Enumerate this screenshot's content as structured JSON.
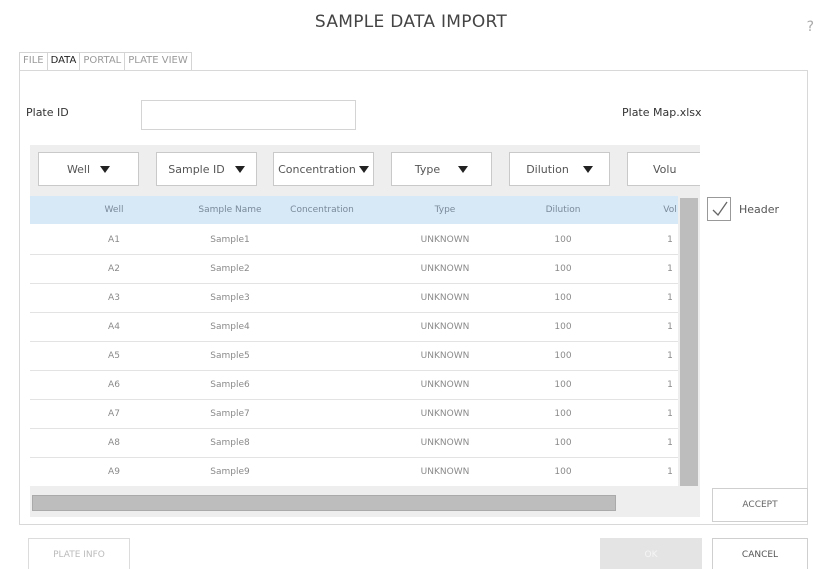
{
  "window": {
    "title": "SAMPLE DATA IMPORT",
    "help_label": "?"
  },
  "tabs": [
    {
      "label": "FILE",
      "active": false
    },
    {
      "label": "DATA",
      "active": true
    },
    {
      "label": "PORTAL",
      "active": false
    },
    {
      "label": "PLATE VIEW",
      "active": false
    }
  ],
  "plate": {
    "id_label": "Plate ID",
    "id_value": "",
    "file_name": "Plate Map.xlsx"
  },
  "mapping_dropdowns": [
    {
      "label": "Well"
    },
    {
      "label": "Sample ID"
    },
    {
      "label": "Concentration"
    },
    {
      "label": "Type"
    },
    {
      "label": "Dilution"
    },
    {
      "label": "Volu"
    }
  ],
  "table": {
    "columns": [
      "Well",
      "Sample Name",
      "Concentration",
      "Type",
      "Dilution",
      "Vol"
    ],
    "rows": [
      [
        "A1",
        "Sample1",
        "",
        "UNKNOWN",
        "100",
        "1"
      ],
      [
        "A2",
        "Sample2",
        "",
        "UNKNOWN",
        "100",
        "1"
      ],
      [
        "A3",
        "Sample3",
        "",
        "UNKNOWN",
        "100",
        "1"
      ],
      [
        "A4",
        "Sample4",
        "",
        "UNKNOWN",
        "100",
        "1"
      ],
      [
        "A5",
        "Sample5",
        "",
        "UNKNOWN",
        "100",
        "1"
      ],
      [
        "A6",
        "Sample6",
        "",
        "UNKNOWN",
        "100",
        "1"
      ],
      [
        "A7",
        "Sample7",
        "",
        "UNKNOWN",
        "100",
        "1"
      ],
      [
        "A8",
        "Sample8",
        "",
        "UNKNOWN",
        "100",
        "1"
      ],
      [
        "A9",
        "Sample9",
        "",
        "UNKNOWN",
        "100",
        "1"
      ]
    ]
  },
  "options": {
    "header_label": "Header",
    "header_checked": true
  },
  "buttons": {
    "accept": "ACCEPT",
    "plate_info": "PLATE INFO",
    "ok": "OK",
    "cancel": "CANCEL"
  }
}
